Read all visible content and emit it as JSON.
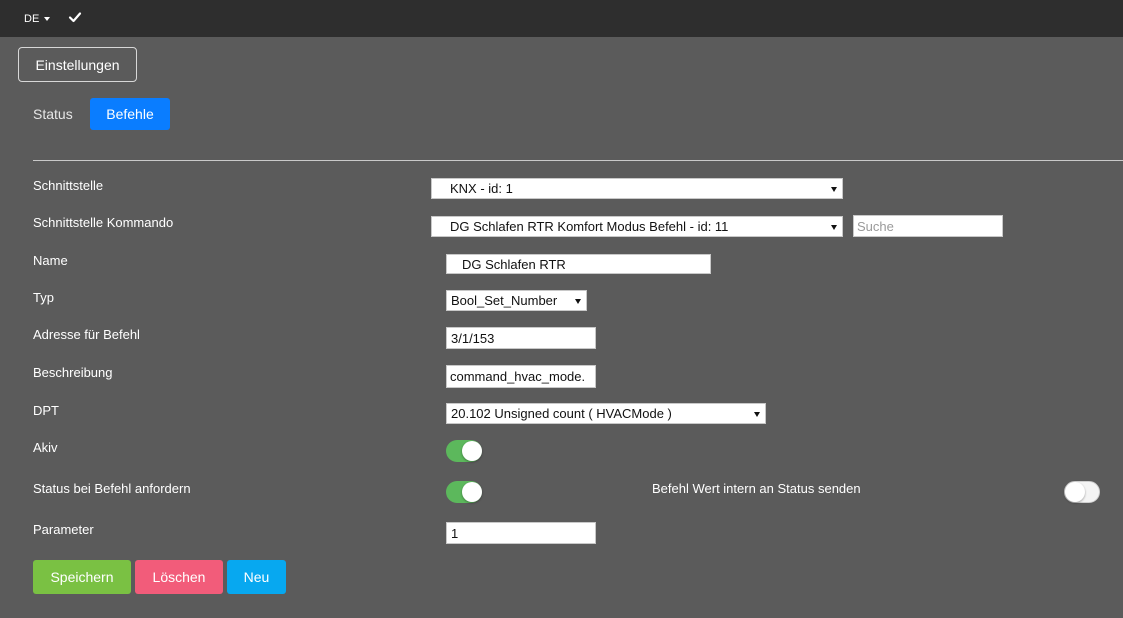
{
  "topbar": {
    "language": "DE",
    "language_icon": "caret-down-icon",
    "check_icon": "check-icon"
  },
  "settings_button": "Einstellungen",
  "tabs": {
    "status": "Status",
    "befehle": "Befehle"
  },
  "form": {
    "schnittstelle": {
      "label": "Schnittstelle",
      "value": "KNX - id: 1"
    },
    "schnittstelle_kommando": {
      "label": "Schnittstelle Kommando",
      "value": "DG Schlafen RTR Komfort Modus Befehl - id: 11",
      "search_placeholder": "Suche"
    },
    "name": {
      "label": "Name",
      "value": "DG Schlafen RTR"
    },
    "typ": {
      "label": "Typ",
      "value": "Bool_Set_Number"
    },
    "adresse": {
      "label": "Adresse für Befehl",
      "value": "3/1/153"
    },
    "beschreibung": {
      "label": "Beschreibung",
      "value": "command_hvac_mode."
    },
    "dpt": {
      "label": "DPT",
      "value": "20.102 Unsigned count ( HVACMode )"
    },
    "akiv": {
      "label": "Akiv",
      "enabled": true
    },
    "status_anfordern": {
      "label": "Status bei Befehl anfordern",
      "enabled": true
    },
    "wert_intern": {
      "label": "Befehl Wert intern an Status senden",
      "enabled": false
    },
    "parameter": {
      "label": "Parameter",
      "value": "1"
    }
  },
  "buttons": {
    "save": "Speichern",
    "delete": "Löschen",
    "new": "Neu"
  },
  "colors": {
    "primary": "#0a7dff",
    "success": "#7ac143",
    "danger": "#f25c7a",
    "info": "#07a8f0",
    "toggle_on": "#5cb85c"
  }
}
